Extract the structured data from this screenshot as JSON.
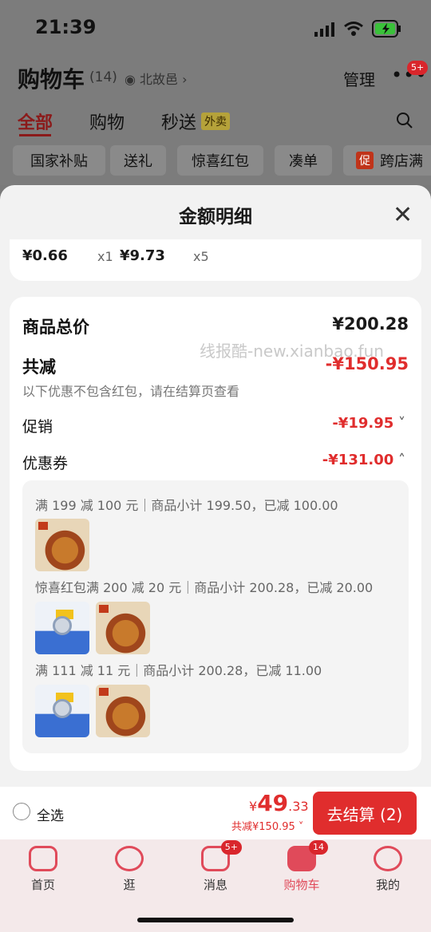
{
  "status": {
    "time": "21:39"
  },
  "header": {
    "title": "购物车",
    "count": "(14)",
    "location": "北故邑 ›",
    "manage": "管理",
    "more_badge": "5+"
  },
  "tabs": [
    {
      "label": "全部"
    },
    {
      "label": "购物"
    },
    {
      "label": "秒送"
    }
  ],
  "waimai": "外卖",
  "chips": [
    "国家补贴",
    "送礼",
    "惊喜红包",
    "凑单",
    "跨店满"
  ],
  "chip_promo_icon": "促",
  "sheet": {
    "title": "金额明细"
  },
  "top_items": [
    {
      "price": "¥0.66",
      "qty": "x1"
    },
    {
      "price": "¥9.73",
      "qty": "x5"
    }
  ],
  "summary": {
    "goods_label": "商品总价",
    "goods_value": "¥200.28",
    "reduce_label": "共减",
    "reduce_value": "-¥150.95",
    "note": "以下优惠不包含红包，请在结算页查看",
    "promo_label": "促销",
    "promo_value": "-¥19.95",
    "coupon_label": "优惠券",
    "coupon_value": "-¥131.00"
  },
  "watermark": "线报酷-new.xianbao.fun",
  "coupons": [
    {
      "text": "满 199 减 100 元｜商品小计 199.50，已减 100.00"
    },
    {
      "text": "惊喜红包满 200 减 20 元｜商品小计 200.28，已减 20.00"
    },
    {
      "text": "满 111 减 11 元｜商品小计 200.28，已减 11.00"
    }
  ],
  "checkout": {
    "select_all": "全选",
    "currency": "¥",
    "amount": "49",
    "decimal": ".33",
    "reduced": "共减¥150.95",
    "button": "去结算 (2)"
  },
  "nav": [
    {
      "label": "首页"
    },
    {
      "label": "逛"
    },
    {
      "label": "消息",
      "badge": "5+"
    },
    {
      "label": "购物车",
      "badge": "14"
    },
    {
      "label": "我的"
    }
  ],
  "colors": {
    "accent": "#e02d2d"
  }
}
